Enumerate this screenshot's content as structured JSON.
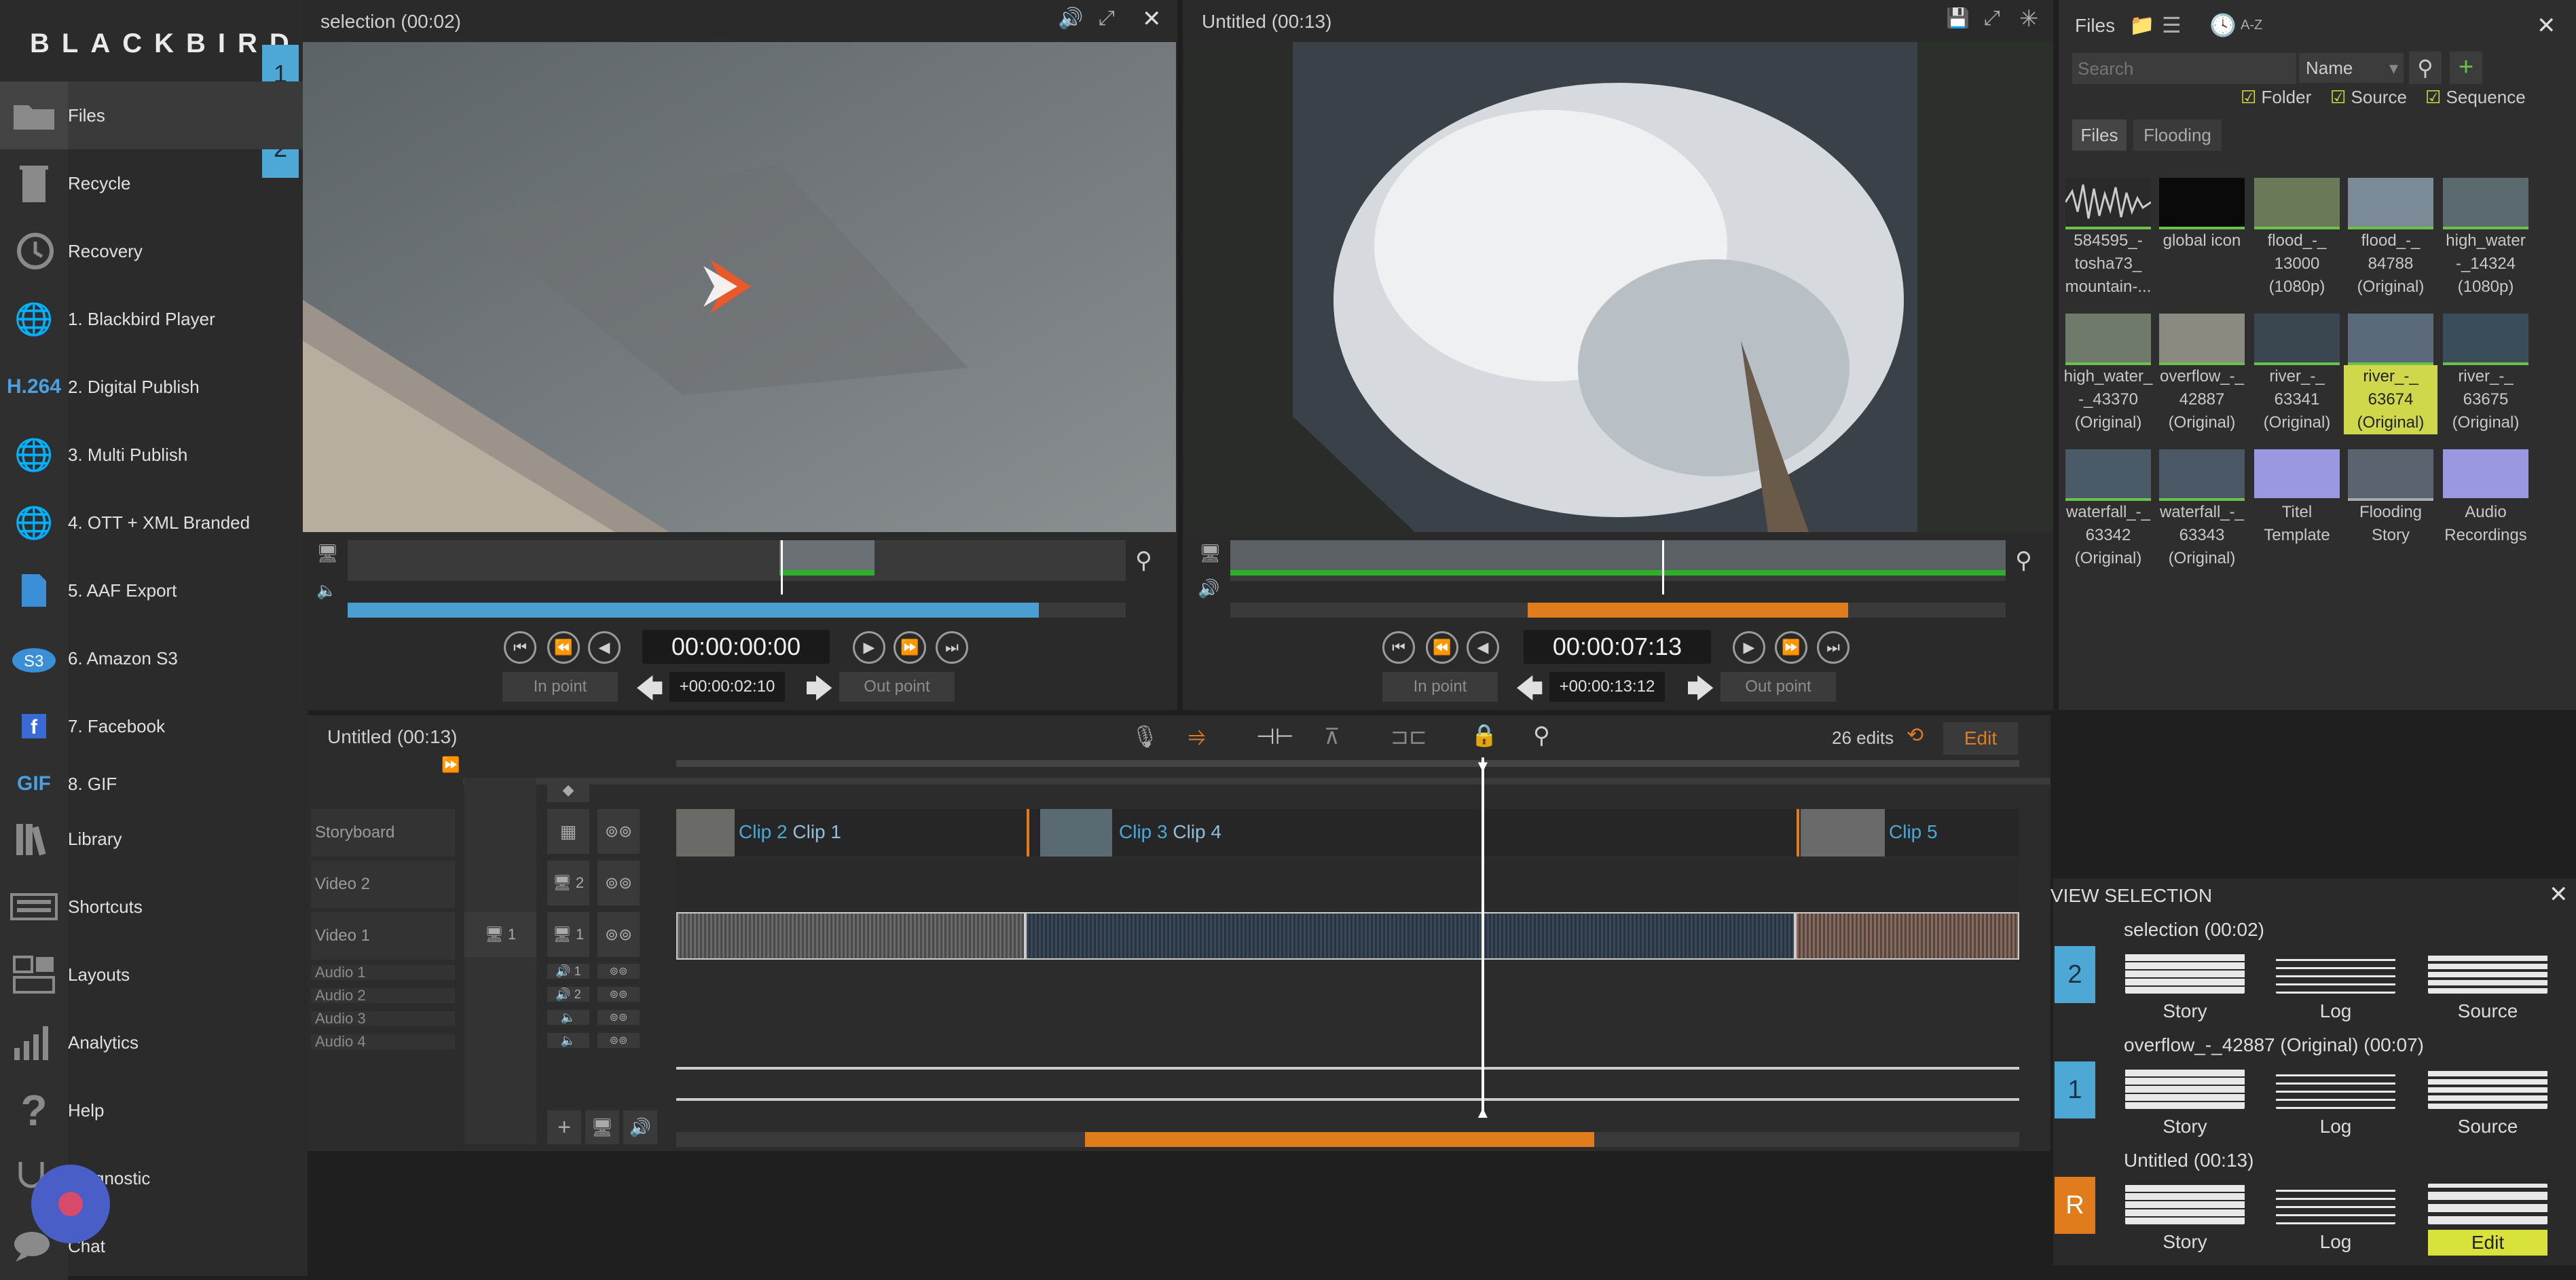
{
  "app": {
    "logo": "BLACKBIRD"
  },
  "sidebar": {
    "tabs": [
      "1",
      "2"
    ],
    "items": [
      {
        "label": "Files",
        "icon": "folder-icon"
      },
      {
        "label": "Recycle",
        "icon": "recycle-icon"
      },
      {
        "label": "Recovery",
        "icon": "history-icon"
      },
      {
        "label": "1. Blackbird Player",
        "icon": "globe-icon"
      },
      {
        "label": "2. Digital Publish",
        "icon": "h264-icon",
        "icon_text": "H.264"
      },
      {
        "label": "3. Multi Publish",
        "icon": "globe-icon"
      },
      {
        "label": "4. OTT + XML Branded",
        "icon": "globe-icon"
      },
      {
        "label": "5. AAF Export",
        "icon": "aaf-file-icon"
      },
      {
        "label": "6. Amazon S3",
        "icon": "s3-cloud-icon",
        "icon_text": "S3"
      },
      {
        "label": "7. Facebook",
        "icon": "facebook-icon",
        "icon_text": "f"
      },
      {
        "label": "8. GIF",
        "icon": "gif-icon",
        "icon_text": "GIF"
      },
      {
        "label": "Library",
        "icon": "library-icon"
      },
      {
        "label": "Shortcuts",
        "icon": "keyboard-icon"
      },
      {
        "label": "Layouts",
        "icon": "layouts-icon"
      },
      {
        "label": "Analytics",
        "icon": "analytics-icon"
      },
      {
        "label": "Help",
        "icon": "help-icon"
      },
      {
        "label": "Diagnostic",
        "icon": "stethoscope-icon"
      },
      {
        "label": "Chat",
        "icon": "chat-icon"
      }
    ]
  },
  "source_viewer": {
    "title": "selection (00:02)",
    "timecode": "00:00:00:00",
    "in_point": "In point",
    "out_point": "Out point",
    "duration": "+00:00:02:10"
  },
  "record_viewer": {
    "title": "Untitled (00:13)",
    "timecode": "00:00:07:13",
    "in_point": "In point",
    "out_point": "Out point",
    "duration": "+00:00:13:12"
  },
  "files_panel": {
    "title": "Files",
    "sort": "A-Z",
    "search_placeholder": "Search",
    "sort_field": "Name",
    "filters": [
      "Folder",
      "Source",
      "Sequence"
    ],
    "tabs": [
      "Files",
      "Flooding"
    ],
    "items": [
      {
        "caption": "584595_-\ntosha73_\nmountain-..."
      },
      {
        "caption": "global icon"
      },
      {
        "caption": "flood_-_\n13000\n(1080p)"
      },
      {
        "caption": "flood_-_\n84788\n(Original)"
      },
      {
        "caption": "high_water\n-_14324\n(1080p)"
      },
      {
        "caption": "high_water_\n-_43370\n(Original)"
      },
      {
        "caption": "overflow_-_\n42887\n(Original)"
      },
      {
        "caption": "river_-_\n63341\n(Original)"
      },
      {
        "caption": "river_-_\n63674\n(Original)",
        "selected": true
      },
      {
        "caption": "river_-_\n63675\n(Original)"
      },
      {
        "caption": "waterfall_-_\n63342\n(Original)"
      },
      {
        "caption": "waterfall_-_\n63343\n(Original)"
      },
      {
        "caption": "Titel\nTemplate"
      },
      {
        "caption": "Flooding\nStory"
      },
      {
        "caption": "Audio\nRecordings"
      }
    ]
  },
  "timeline": {
    "title": "Untitled (00:13)",
    "edits": "26 edits",
    "mode_button": "Edit",
    "tracks": [
      "Storyboard",
      "Video 2",
      "Video 1",
      "Audio 1",
      "Audio 2",
      "Audio 3",
      "Audio 4"
    ],
    "track_nums": {
      "v2": "2",
      "v1a": "1",
      "v1b": "1",
      "a1": "1",
      "a2": "2"
    },
    "clips": [
      {
        "label": "Clip 2",
        "label2": "Clip 1"
      },
      {
        "label": "Clip 3",
        "label2": "Clip 4"
      },
      {
        "label": "Clip 5",
        "label2": ""
      }
    ]
  },
  "view_selection": {
    "title": "VIEW SELECTION",
    "rows": [
      {
        "num": "2",
        "title": "selection (00:02)",
        "buttons": [
          "Story",
          "Log",
          "Source"
        ]
      },
      {
        "num": "1",
        "title": "overflow_-_42887 (Original) (00:07)",
        "buttons": [
          "Story",
          "Log",
          "Source"
        ]
      },
      {
        "num": "R",
        "title": "Untitled (00:13)",
        "buttons": [
          "Story",
          "Log",
          "Edit"
        ]
      }
    ]
  },
  "colors": {
    "accent_blue": "#4ea8d6",
    "accent_orange": "#e07c1c",
    "edit_yellow": "#d8e23a",
    "green_bar": "#2fae2a"
  }
}
